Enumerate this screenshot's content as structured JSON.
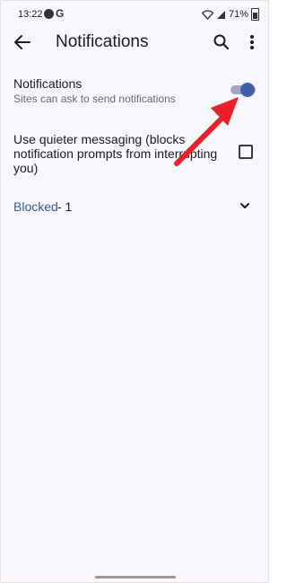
{
  "status_bar": {
    "time": "13:22",
    "battery": "71%"
  },
  "header": {
    "title": "Notifications"
  },
  "settings": {
    "notifications": {
      "title": "Notifications",
      "subtitle": "Sites can ask to send notifications",
      "enabled": true
    },
    "quieter": {
      "label": "Use quieter messaging (blocks notification prompts from interrupting you)",
      "checked": false
    },
    "blocked": {
      "label": "Blocked",
      "count": "- 1"
    }
  },
  "colors": {
    "accent": "#3d5ea9",
    "link": "#35599e",
    "annotation_arrow": "#e8202a",
    "background": "#f8f7fc"
  }
}
